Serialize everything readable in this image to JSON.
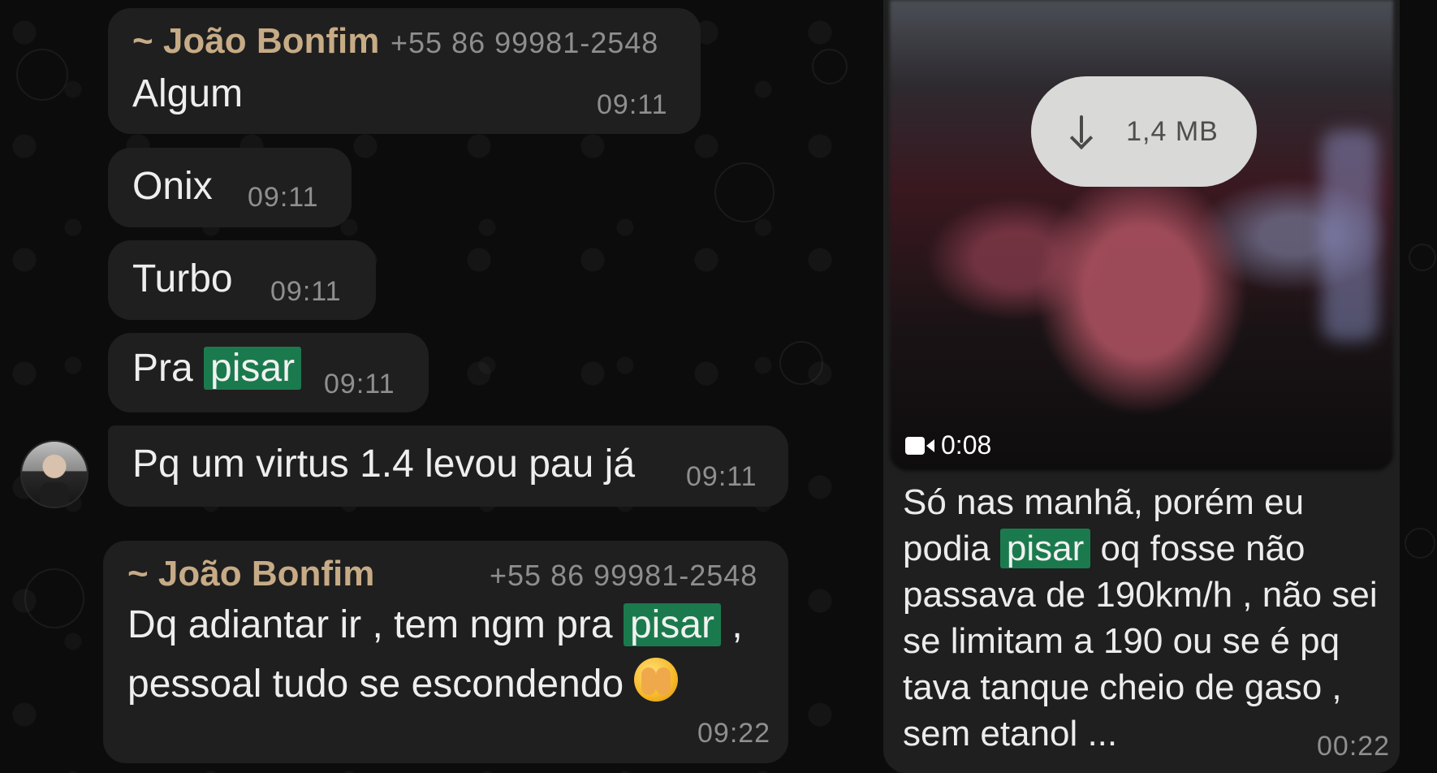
{
  "left_chat": {
    "bubble1": {
      "sender": "~ João Bonfim",
      "phone": "+55 86 99981-2548",
      "text": "Algum",
      "time": "09:11"
    },
    "bubble2": {
      "text": "Onix",
      "time": "09:11"
    },
    "bubble3": {
      "text": "Turbo",
      "time": "09:11"
    },
    "bubble4": {
      "text_before": "Pra",
      "highlight": "pisar",
      "time": "09:11"
    },
    "bubble5": {
      "text": "Pq um virtus 1.4 levou pau já",
      "time": "09:11"
    },
    "bubble6": {
      "sender": "~ João Bonfim",
      "phone": "+55 86 99981-2548",
      "line1_before": "Dq adiantar ir , tem ngm pra",
      "line1_highlight": "pisar",
      "line1_after": ",",
      "line2": "pessoal tudo se escondendo",
      "emoji": "see-no-evil-face",
      "time": "09:22"
    }
  },
  "right_chat": {
    "video": {
      "download_size": "1,4 MB",
      "duration": "0:08"
    },
    "caption": {
      "line1": "Só nas manhã, porém eu",
      "line2_before": "podia",
      "line2_highlight": "pisar",
      "line2_after": "oq fosse não",
      "line3": "passava de 190km/h , não sei",
      "line4": "se limitam a 190 ou se é pq",
      "line5": "tava tanque cheio de gaso ,",
      "line6": "sem etanol ..."
    },
    "time": "00:22"
  },
  "colors": {
    "highlight": "#1b7a4d",
    "sender": "#c7ab86",
    "bubble": "#1f1f1f"
  }
}
